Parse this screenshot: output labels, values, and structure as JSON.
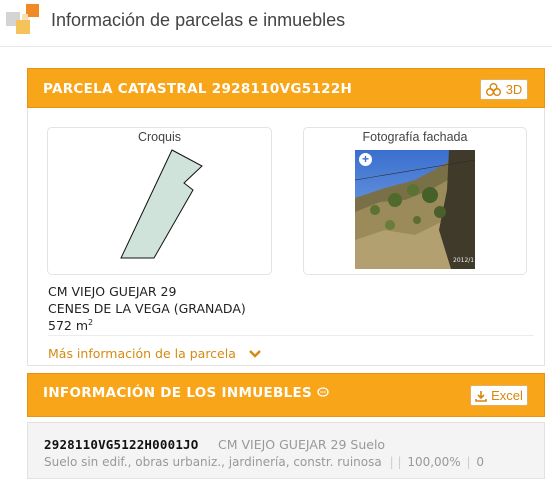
{
  "header": {
    "title": "Información de parcelas e inmuebles"
  },
  "parcela": {
    "title": "PARCELA CATASTRAL 2928110VG5122H",
    "btn_3d": "3D",
    "croquis_label": "Croquis",
    "foto_label": "Fotografía fachada",
    "photo_stamp": "2012/1",
    "address_line1": "CM VIEJO GUEJAR 29",
    "address_line2": "CENES DE LA VEGA (GRANADA)",
    "area": "572 m",
    "area_unit_sup": "2",
    "more_info": "Más información de la parcela"
  },
  "inmuebles": {
    "title": "INFORMACIÓN DE LOS INMUEBLES",
    "btn_excel": "Excel",
    "rows": [
      {
        "ref": "2928110VG5122H0001JO",
        "address": "CM VIEJO GUEJAR 29 Suelo",
        "detail": "Suelo sin edif., obras urbaniz., jardinería, constr. ruinosa",
        "sep1": "|",
        "sep2": "|",
        "percent": "100,00%",
        "sep3": "|",
        "count": "0"
      }
    ]
  },
  "colors": {
    "accent": "#f9a51a",
    "link": "#d58a12",
    "parcel_fill": "#cfe3da"
  },
  "icons": [
    "cadastre-logo-icon",
    "3d-view-icon",
    "expand-photo-icon",
    "chevron-down-icon",
    "chat-bubble-icon",
    "download-icon"
  ]
}
